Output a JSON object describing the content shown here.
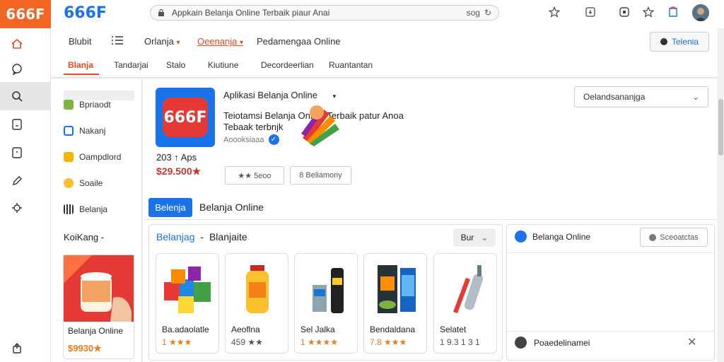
{
  "logo": {
    "text": "666F",
    "bg": "#f26522"
  },
  "brand": {
    "text": "666F",
    "color": "#1a73e8"
  },
  "urlbar": {
    "text": "Appkain Belanja Online Terbaik  piaur Anai",
    "tail": "sog"
  },
  "toolbar": {
    "login_label": "Telenia"
  },
  "nav": {
    "items": [
      "Blubit",
      "Orlanja",
      "Oeenanja",
      "Pedamengaa Online"
    ]
  },
  "tabs": [
    "Blanja",
    "Tandarjai",
    "Stalo",
    "Kiutiune",
    "Decordeerlian",
    "Ruantantan"
  ],
  "sidebar": {
    "items": [
      "Bpriaodt",
      "Nakanj",
      "Oampdlord",
      "Soaile",
      "Belanja"
    ],
    "section_title": "KoiKang -",
    "promo": {
      "name": "Belanja Online",
      "price": "$9930★"
    }
  },
  "app": {
    "icon_text": "666F",
    "title": "Aplikasi Belanja Online",
    "subtitle": "Teiotamsi Belanja Online Terbaik patur Anoa Tebaak terbnjk",
    "developer": "Aoooksiaaa",
    "meta": "203 ↑ Aps",
    "price": "$29.500★",
    "btn_rating": "★★ 5eoo",
    "btn_review": "8 Beliamony",
    "select_label": "Oelandsananjga"
  },
  "section": {
    "pill": "Belenja",
    "title": "Belanja Online"
  },
  "products": {
    "heading_prefix": "Belanjag",
    "heading_sep": "-",
    "heading_suffix": "Blanjaite",
    "sort_label": "Bur",
    "items": [
      {
        "name": "Ba.adaolatle",
        "price": "1 ★★★"
      },
      {
        "name": "Aeoflna",
        "price": "459 ★★"
      },
      {
        "name": "Sel Jalka",
        "price": "1 ★★★★"
      },
      {
        "name": "Bendaldana",
        "price": "7.8 ★★★"
      },
      {
        "name": "Selatet",
        "price": "1 9.3 1 3 1"
      }
    ]
  },
  "right_panel": {
    "title": "Belanga Online",
    "button": "Sceoatctas",
    "footer": "Poaedelinamei"
  },
  "colors": {
    "accent": "#1a73e8",
    "orange": "#e8491d",
    "star": "#e67e22"
  }
}
